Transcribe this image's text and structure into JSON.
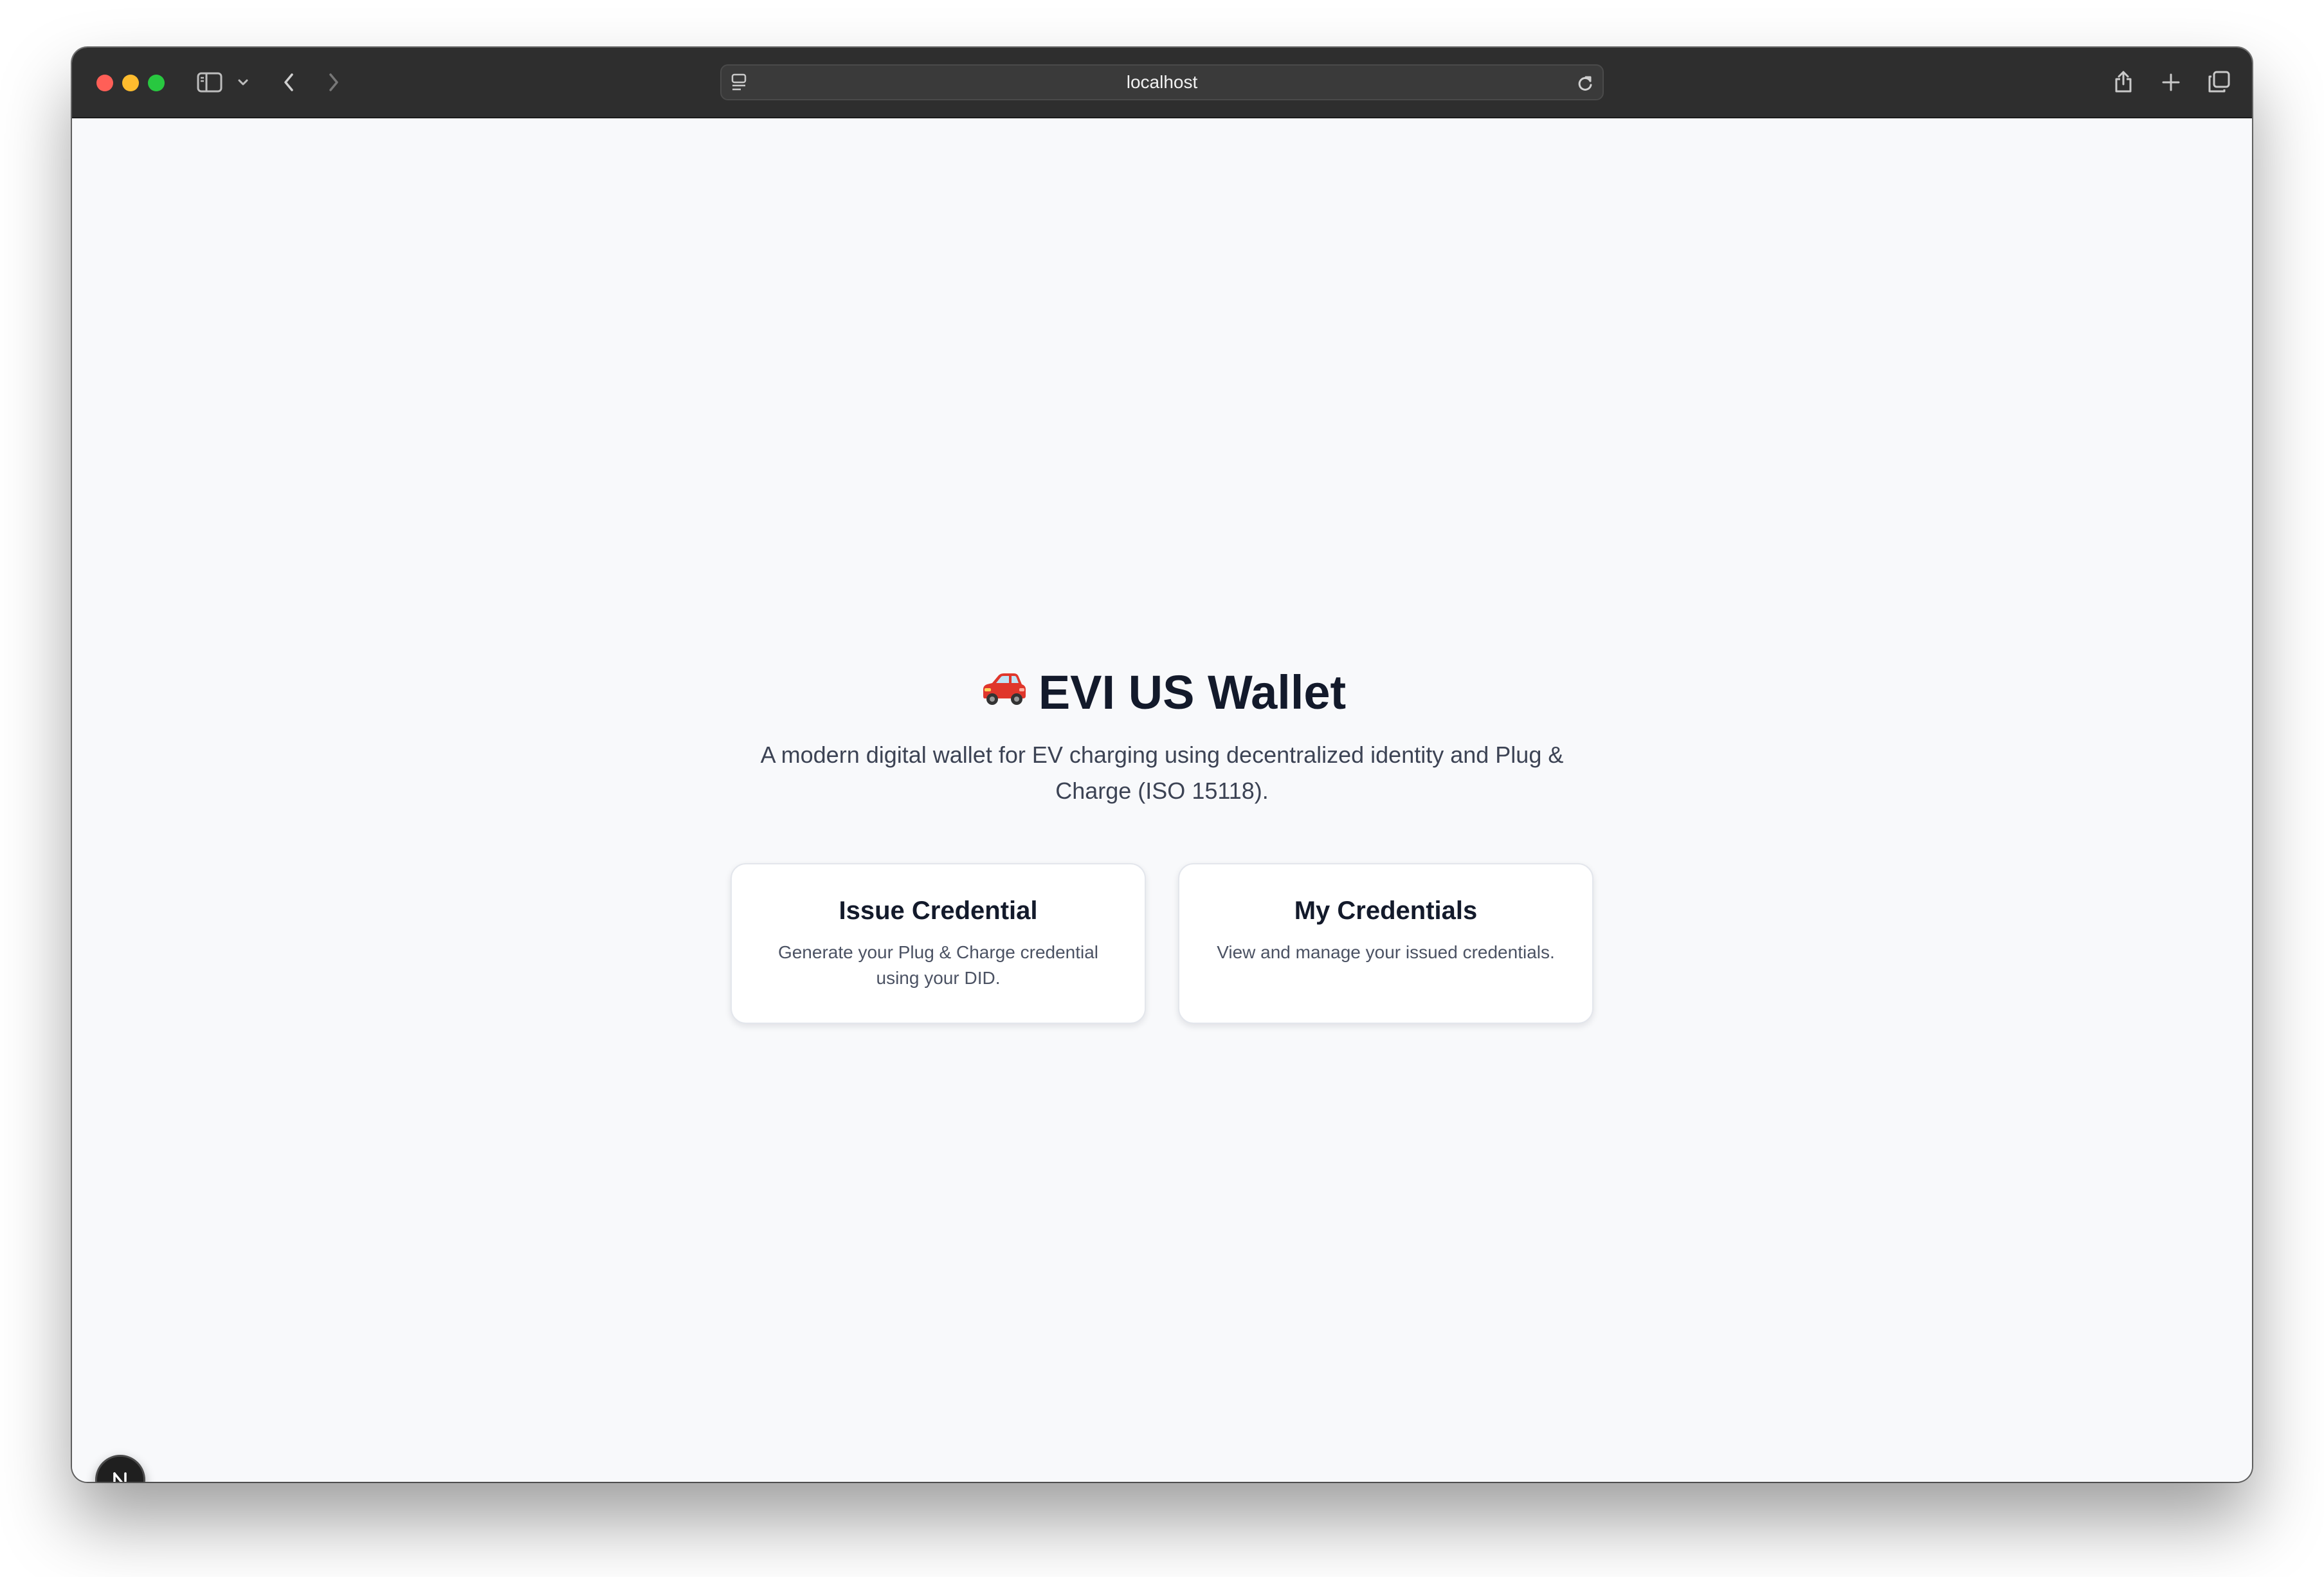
{
  "browser": {
    "url": "localhost",
    "icons": {
      "sidebar": "sidebar-icon",
      "sidebar_menu": "chevron-down-icon",
      "back": "chevron-left-icon",
      "forward": "chevron-right-icon",
      "page_settings": "page-settings-icon",
      "reload": "reload-icon",
      "share": "share-icon",
      "new_tab": "plus-icon",
      "tab_overview": "tabs-icon"
    }
  },
  "hero": {
    "title": "EVI US Wallet",
    "emoji": "car-icon",
    "subtitle": "A modern digital wallet for EV charging using decentralized identity and Plug & Charge (ISO 15118)."
  },
  "cards": [
    {
      "title": "Issue Credential",
      "description": "Generate your Plug & Charge credential using your DID."
    },
    {
      "title": "My Credentials",
      "description": "View and manage your issued credentials."
    }
  ],
  "dev_badge": {
    "label": "N"
  },
  "colors": {
    "page_background": "#f8f9fb",
    "titlebar": "#2e2e2e",
    "heading": "#131a2b",
    "body_text": "#3c4354",
    "card_border": "#e3e6ec",
    "car_red": "#e0362b"
  }
}
